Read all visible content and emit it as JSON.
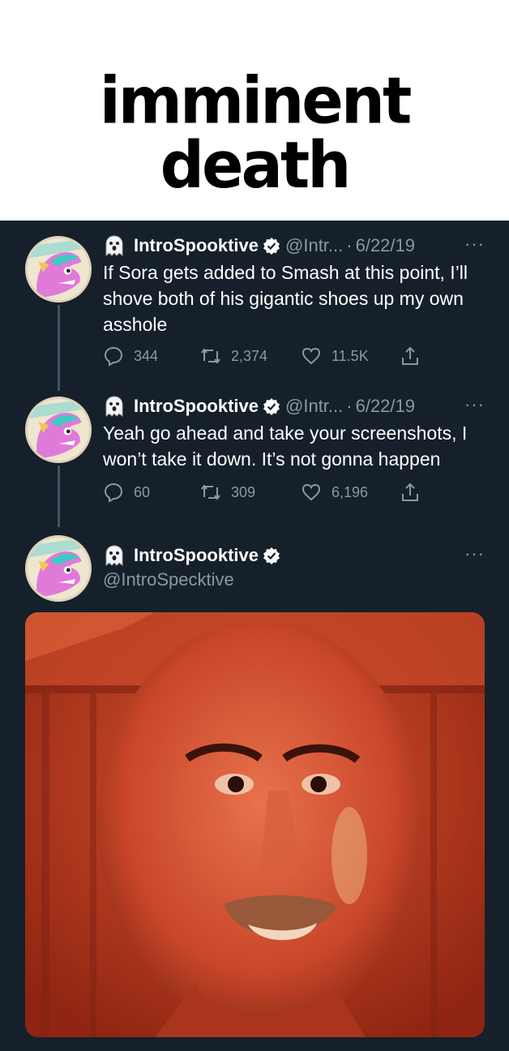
{
  "caption": "imminent death",
  "tweets": [
    {
      "name": "IntroSpooktive",
      "handle": "@Intr...",
      "separator": "·",
      "date": "6/22/19",
      "more": "···",
      "text": "If Sora gets added to Smash at this point, I’ll shove both of his gigantic shoes up my own asshole",
      "replies": "344",
      "retweets": "2,374",
      "likes": "11.5K"
    },
    {
      "name": "IntroSpooktive",
      "handle": "@Intr...",
      "separator": "·",
      "date": "6/22/19",
      "more": "···",
      "text": "Yeah go ahead and take your screenshots, I won’t take it down. It’s not gonna happen",
      "replies": "60",
      "retweets": "309",
      "likes": "6,196"
    },
    {
      "name": "IntroSpooktive",
      "handle": "@IntroSpecktive",
      "more": "···"
    }
  ],
  "icons": [
    "ghost-emoji-icon",
    "verified-badge-icon",
    "reply-icon",
    "retweet-icon",
    "like-icon",
    "share-icon",
    "more-icon"
  ],
  "colors": {
    "background": "#15202b",
    "secondary_text": "#8899a6",
    "verified": "#ffffff"
  }
}
